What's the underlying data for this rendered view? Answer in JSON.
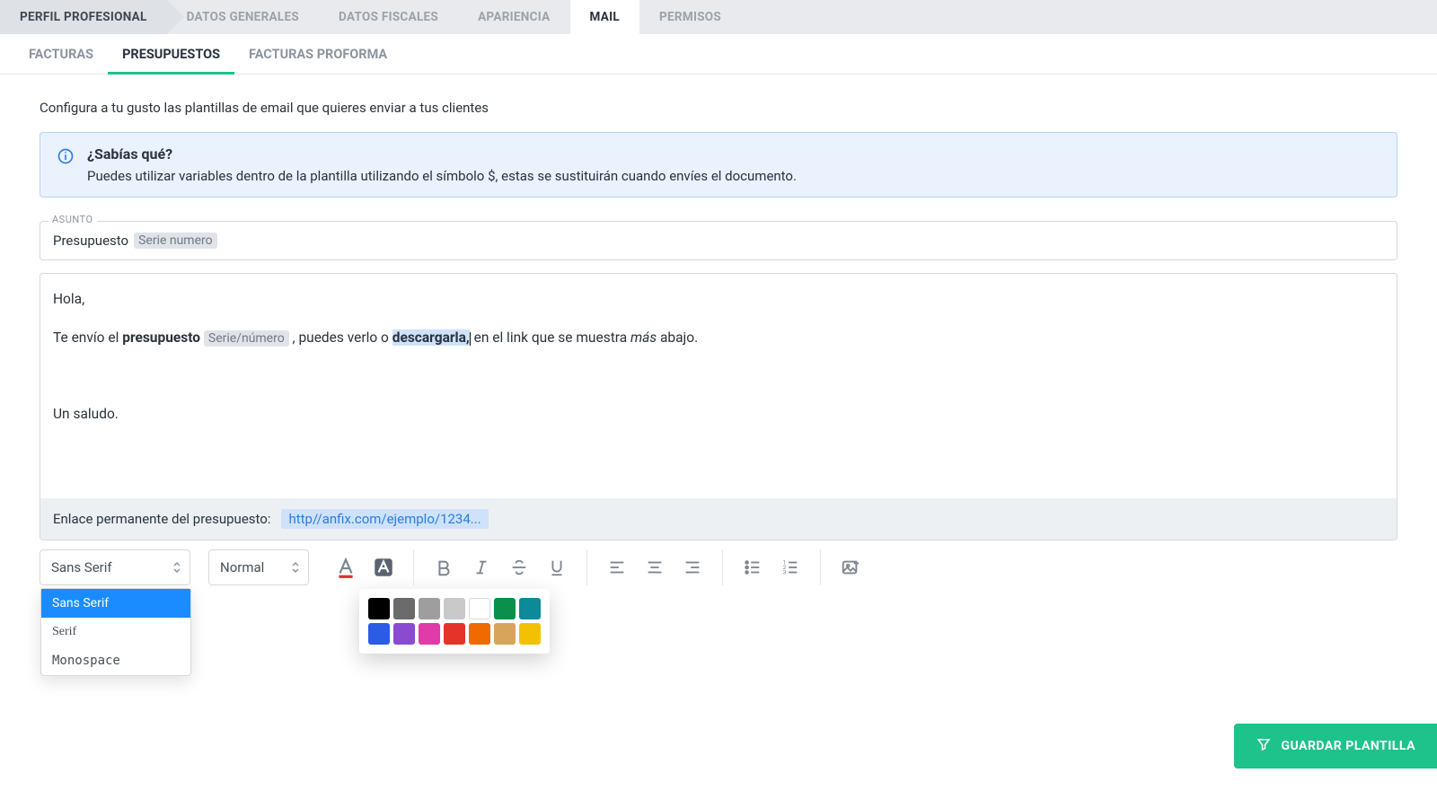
{
  "mainTabs": {
    "t0": "PERFIL PROFESIONAL",
    "t1": "DATOS GENERALES",
    "t2": "DATOS FISCALES",
    "t3": "APARIENCIA",
    "t4": "MAIL",
    "t5": "PERMISOS"
  },
  "subTabs": {
    "s0": "FACTURAS",
    "s1": "PRESUPUESTOS",
    "s2": "FACTURAS PROFORMA"
  },
  "intro": "Configura a tu gusto las plantillas de email que quieres enviar a tus clientes",
  "info": {
    "title": "¿Sabías qué?",
    "text": "Puedes utilizar variables dentro de la plantilla utilizando el símbolo $, estas se sustituirán cuando envíes el documento."
  },
  "subject": {
    "label": "ASUNTO",
    "prefix": "Presupuesto",
    "chip": "Serie numero"
  },
  "body": {
    "greeting": "Hola,",
    "l2a": "Te envío el ",
    "l2b": "presupuesto",
    "l2chip": "Serie/número",
    "l2c": " , puedes verlo o ",
    "l2sel": "descargarla,",
    "l2d": " en el link que se muestra ",
    "l2e": "más",
    "l2f": " abajo.",
    "signoff": "Un saludo."
  },
  "linkRow": {
    "label": "Enlace permanente del presupuesto:",
    "url": "http//anfix.com/ejemplo/1234..."
  },
  "toolbar": {
    "fontSelected": "Sans Serif",
    "headingSelected": "Normal",
    "fontOptions": {
      "o0": "Sans Serif",
      "o1": "Serif",
      "o2": "Monospace"
    }
  },
  "palette": {
    "c0": "#000000",
    "c1": "#6b6b6b",
    "c2": "#9e9e9e",
    "c3": "#c9c9c9",
    "c4": "#ffffff",
    "c5": "#0a8f4d",
    "c6": "#0c8a99",
    "c7": "#2b5ce6",
    "c8": "#8a4bd1",
    "c9": "#e03ba8",
    "c10": "#e6332a",
    "c11": "#f06a00",
    "c12": "#d6a45a",
    "c13": "#f2c200"
  },
  "saveButtonLabel": "GUARDAR PLANTILLA"
}
